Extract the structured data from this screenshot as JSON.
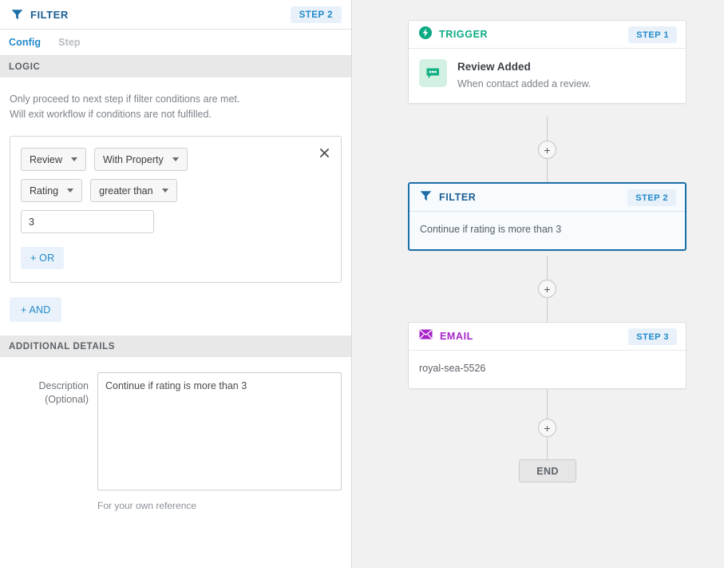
{
  "left_panel": {
    "header": {
      "icon": "funnel-icon",
      "title": "FILTER",
      "step_badge": "STEP 2"
    },
    "tabs": [
      {
        "label": "Config",
        "active": true
      },
      {
        "label": "Step",
        "active": false
      }
    ],
    "logic_section": {
      "band_title": "LOGIC",
      "hint_line_1": "Only proceed to next step if filter conditions are met.",
      "hint_line_2": "Will exit workflow if conditions are not fulfilled.",
      "condition": {
        "close_icon": "close-icon",
        "object_dropdown": "Review",
        "match_dropdown": "With Property",
        "field_dropdown": "Rating",
        "operator_dropdown": "greater than",
        "value": "3",
        "value_placeholder": "",
        "or_button": "+ OR"
      },
      "and_button": "+ AND"
    },
    "additional_details": {
      "band_title": "ADDITIONAL DETAILS",
      "description_label_line1": "Description",
      "description_label_line2": "(Optional)",
      "description_value": "Continue if rating is more than 3",
      "description_placeholder": "",
      "helper_text": "For your own reference"
    }
  },
  "workflow": {
    "nodes": [
      {
        "type": "trigger",
        "icon": "lightning-bolt-icon",
        "title": "TRIGGER",
        "step_badge": "STEP 1",
        "body_icon": "speech-bubble-icon",
        "body_title": "Review Added",
        "body_subtitle": "When contact added a review."
      },
      {
        "type": "filter",
        "icon": "funnel-icon",
        "title": "FILTER",
        "step_badge": "STEP 2",
        "body_text": "Continue if rating is more than 3",
        "selected": true
      },
      {
        "type": "email",
        "icon": "envelope-icon",
        "title": "EMAIL",
        "step_badge": "STEP 3",
        "body_text": "royal-sea-5526"
      }
    ],
    "add_buttons": [
      "+",
      "+",
      "+"
    ],
    "end_label": "END"
  },
  "colors": {
    "accent_blue": "#2289c9",
    "filter_blue": "#1b5e93",
    "trigger_green": "#0aab83",
    "email_purple": "#a723c9",
    "badge_bg": "#e8f1fa",
    "panel_bg": "#f1f1f1",
    "band_bg": "#e8e8e8"
  }
}
